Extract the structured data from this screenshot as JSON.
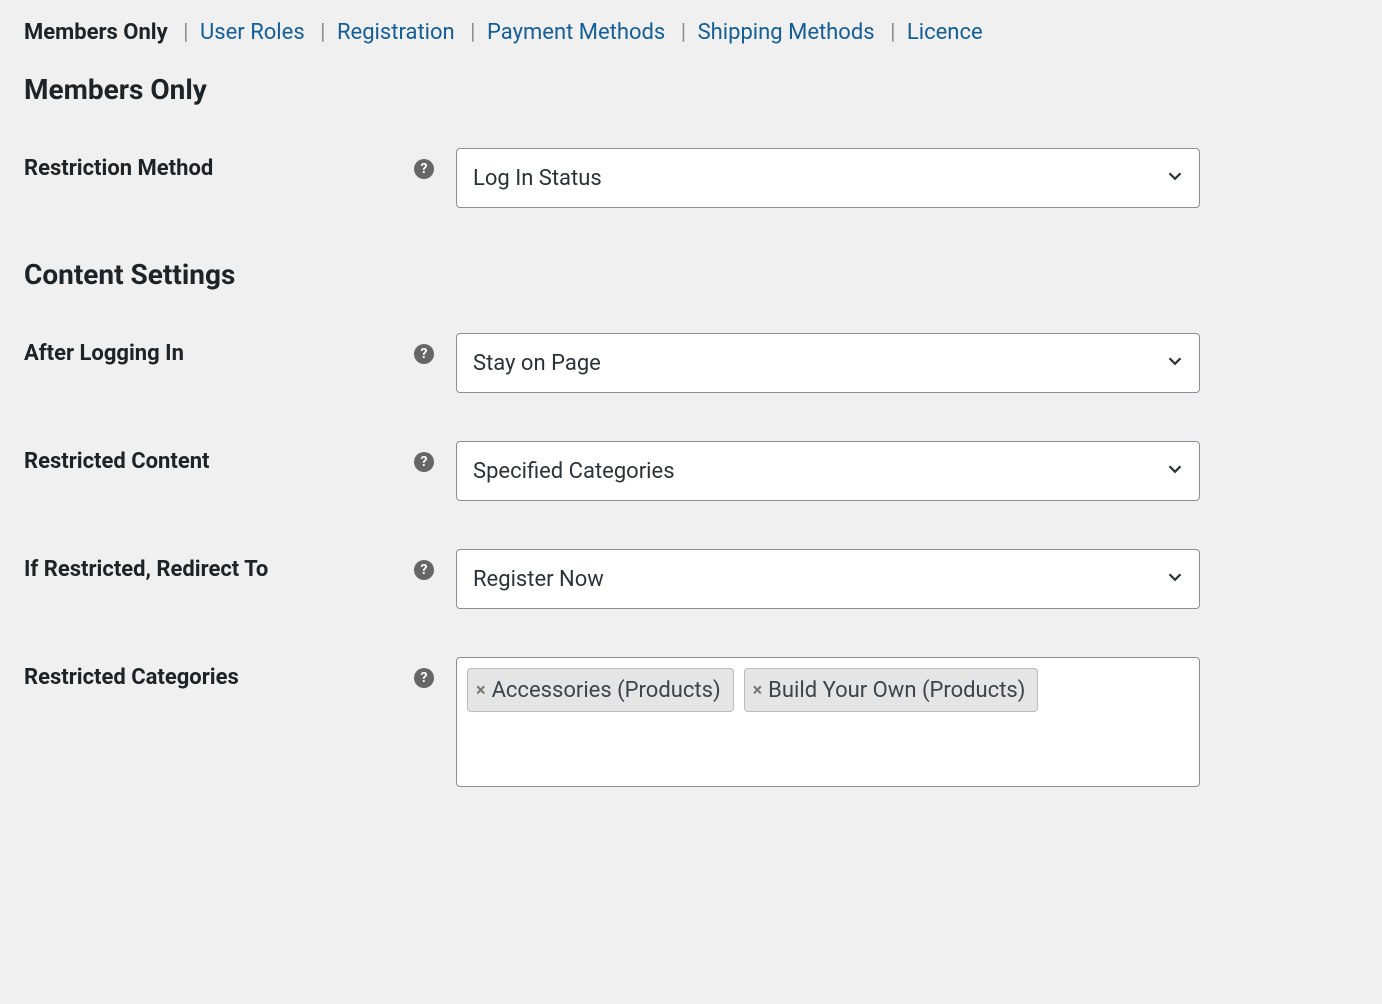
{
  "tabs": {
    "items": [
      {
        "label": "Members Only",
        "active": true
      },
      {
        "label": "User Roles",
        "active": false
      },
      {
        "label": "Registration",
        "active": false
      },
      {
        "label": "Payment Methods",
        "active": false
      },
      {
        "label": "Shipping Methods",
        "active": false
      },
      {
        "label": "Licence",
        "active": false
      }
    ]
  },
  "sections": {
    "members_only": {
      "heading": "Members Only",
      "restriction_method": {
        "label": "Restriction Method",
        "value": "Log In Status"
      }
    },
    "content_settings": {
      "heading": "Content Settings",
      "after_logging_in": {
        "label": "After Logging In",
        "value": "Stay on Page"
      },
      "restricted_content": {
        "label": "Restricted Content",
        "value": "Specified Categories"
      },
      "redirect_to": {
        "label": "If Restricted, Redirect To",
        "value": "Register Now"
      },
      "restricted_categories": {
        "label": "Restricted Categories",
        "tags": [
          "Accessories (Products)",
          "Build Your Own (Products)"
        ]
      }
    }
  },
  "icons": {
    "help": "?"
  }
}
